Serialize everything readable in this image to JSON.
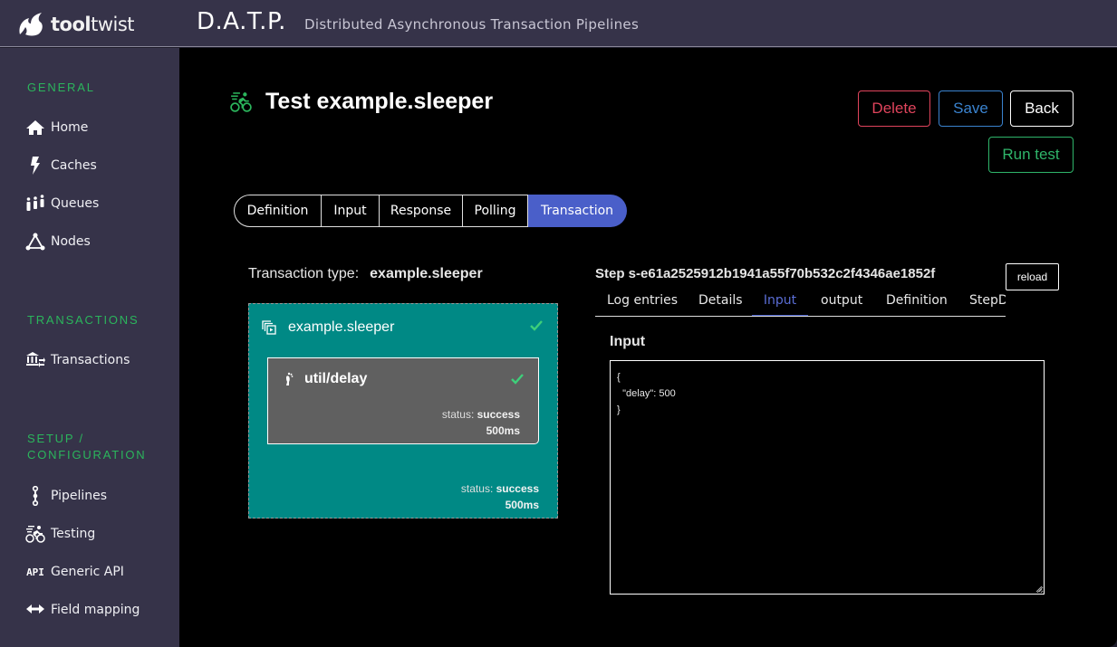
{
  "header": {
    "logo_bold": "tool",
    "logo_light": "twist",
    "app_title": "D.A.T.P.",
    "app_subtitle": "Distributed Asynchronous Transaction Pipelines"
  },
  "sidebar": {
    "sections": [
      {
        "title": "GENERAL",
        "items": [
          {
            "label": "Home",
            "icon": "home-icon"
          },
          {
            "label": "Caches",
            "icon": "lightning-icon"
          },
          {
            "label": "Queues",
            "icon": "people-queue-icon"
          },
          {
            "label": "Nodes",
            "icon": "nodes-icon"
          }
        ]
      },
      {
        "title": "TRANSACTIONS",
        "items": [
          {
            "label": "Transactions",
            "icon": "bank-transfer-icon"
          }
        ]
      },
      {
        "title": "SETUP /\nCONFIGURATION",
        "title_line1": "SETUP /",
        "title_line2": "CONFIGURATION",
        "items": [
          {
            "label": "Pipelines",
            "icon": "pipeline-icon"
          },
          {
            "label": "Testing",
            "icon": "cyclist-icon"
          },
          {
            "label": "Generic API",
            "icon": "api-icon"
          },
          {
            "label": "Field mapping",
            "icon": "arrows-horizontal-icon"
          }
        ]
      }
    ]
  },
  "page": {
    "title": "Test example.sleeper",
    "buttons": {
      "delete": "Delete",
      "save": "Save",
      "back": "Back",
      "run_test": "Run test"
    },
    "tabs": [
      {
        "label": "Definition",
        "active": false
      },
      {
        "label": "Input",
        "active": false
      },
      {
        "label": "Response",
        "active": false
      },
      {
        "label": "Polling",
        "active": false
      },
      {
        "label": "Transaction",
        "active": true
      }
    ],
    "transaction": {
      "type_label": "Transaction type:",
      "type_value": "example.sleeper",
      "pipeline": {
        "name": "example.sleeper",
        "status_label": "status:",
        "status_value": "success",
        "duration": "500ms",
        "step": {
          "name": "util/delay",
          "status_label": "status:",
          "status_value": "success",
          "duration": "500ms"
        }
      }
    },
    "step_panel": {
      "title": "Step s-e61a2525912b1941a55f70b532c2f4346ae1852f",
      "reload_label": "reload",
      "tabs": [
        {
          "label": "Log entries",
          "active": false
        },
        {
          "label": "Details",
          "active": false
        },
        {
          "label": "Input",
          "active": true
        },
        {
          "label": "output",
          "active": false
        },
        {
          "label": "Definition",
          "active": false
        },
        {
          "label": "StepD",
          "active": false
        }
      ],
      "input_label": "Input",
      "input_value": "{\n  \"delay\": 500\n}"
    }
  },
  "colors": {
    "accent": "#4a5fc9",
    "section_green": "#2bb55c",
    "delete": "#e0445c",
    "save": "#3a83cf",
    "run": "#2fb56a",
    "pipeline_bg": "#008985",
    "step_bg": "#606060"
  }
}
